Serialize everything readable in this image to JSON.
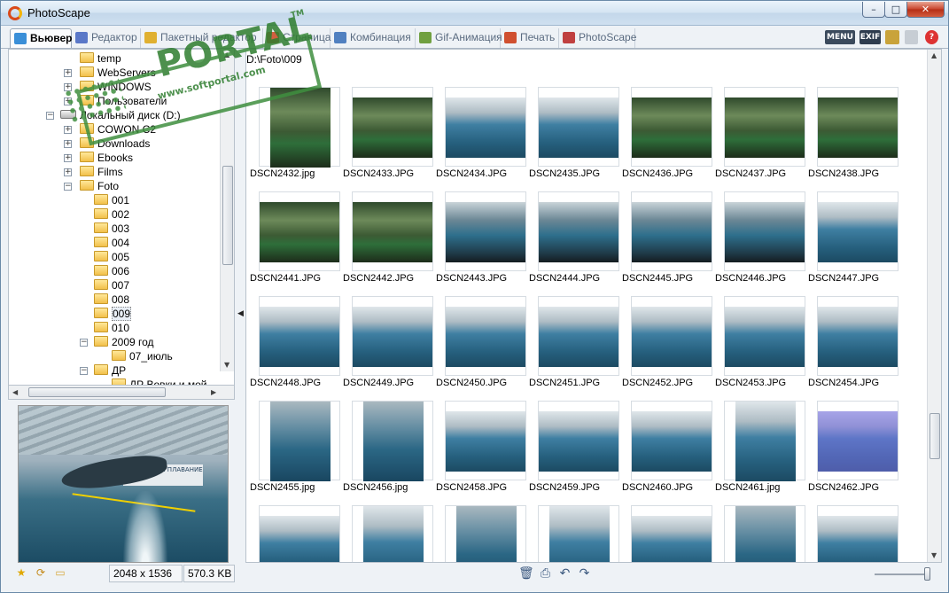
{
  "window": {
    "title": "PhotoScape",
    "min_label": "–",
    "max_label": "□",
    "close_label": "✕"
  },
  "tabs": [
    {
      "label": "Вьювер",
      "icon": "viewer-icon",
      "color": "#3a8fd8",
      "active": true
    },
    {
      "label": "Редактор",
      "icon": "editor-icon",
      "color": "#5a78c8",
      "active": false
    },
    {
      "label": "Пакетный редактор",
      "icon": "batch-editor-icon",
      "color": "#e0b030",
      "active": false
    },
    {
      "label": "Страница",
      "icon": "page-icon",
      "color": "#d06040",
      "active": false
    },
    {
      "label": "Комбинация",
      "icon": "combine-icon",
      "color": "#5080c0",
      "active": false
    },
    {
      "label": "Gif-Анимация",
      "icon": "gif-animation-icon",
      "color": "#70a040",
      "active": false
    },
    {
      "label": "Печать",
      "icon": "print-icon",
      "color": "#d05030",
      "active": false
    },
    {
      "label": "PhotoScape",
      "icon": "photoscape-icon",
      "color": "#c04040",
      "active": false
    }
  ],
  "toolbar_right": {
    "menu_label": "MENU",
    "exif_label": "EXIF",
    "help_label": "?"
  },
  "tree": {
    "items": [
      {
        "label": "temp",
        "type": "folder",
        "expander": ""
      },
      {
        "label": "WebServers",
        "type": "folder",
        "expander": "+"
      },
      {
        "label": "WINDOWS",
        "type": "folder",
        "expander": "+"
      },
      {
        "label": "Пользователи",
        "type": "folder",
        "expander": "+"
      },
      {
        "label": "Локальный диск (D:)",
        "type": "drive",
        "expander": "−"
      },
      {
        "label": "COWON C2",
        "type": "folder",
        "expander": "+"
      },
      {
        "label": "Downloads",
        "type": "folder",
        "expander": "+"
      },
      {
        "label": "Ebooks",
        "type": "folder",
        "expander": "+"
      },
      {
        "label": "Films",
        "type": "folder",
        "expander": "+"
      },
      {
        "label": "Foto",
        "type": "folder",
        "expander": "−"
      },
      {
        "label": "001",
        "type": "folder",
        "expander": ""
      },
      {
        "label": "002",
        "type": "folder",
        "expander": ""
      },
      {
        "label": "003",
        "type": "folder",
        "expander": ""
      },
      {
        "label": "004",
        "type": "folder",
        "expander": ""
      },
      {
        "label": "005",
        "type": "folder",
        "expander": ""
      },
      {
        "label": "006",
        "type": "folder",
        "expander": ""
      },
      {
        "label": "007",
        "type": "folder",
        "expander": ""
      },
      {
        "label": "008",
        "type": "folder",
        "expander": ""
      },
      {
        "label": "009",
        "type": "folder",
        "expander": "",
        "selected": true
      },
      {
        "label": "010",
        "type": "folder",
        "expander": ""
      },
      {
        "label": "2009 год",
        "type": "folder",
        "expander": "−"
      },
      {
        "label": "07_июль",
        "type": "folder",
        "expander": ""
      },
      {
        "label": "ДР",
        "type": "folder",
        "expander": "−"
      },
      {
        "label": "ДР Вовки и мой",
        "type": "folder",
        "expander": ""
      }
    ]
  },
  "status": {
    "dimensions": "2048 x 1536",
    "filesize": "570.3 KB"
  },
  "main": {
    "path": "D:\\Foto\\009",
    "thumbnails": [
      {
        "name": "DSCN2432.jpg",
        "scene": "show",
        "orient": "portrait"
      },
      {
        "name": "DSCN2433.JPG",
        "scene": "show",
        "orient": "landscape"
      },
      {
        "name": "DSCN2434.JPG",
        "scene": "pool",
        "orient": "landscape"
      },
      {
        "name": "DSCN2435.JPG",
        "scene": "pool",
        "orient": "landscape"
      },
      {
        "name": "DSCN2436.JPG",
        "scene": "show",
        "orient": "landscape"
      },
      {
        "name": "DSCN2437.JPG",
        "scene": "show",
        "orient": "landscape"
      },
      {
        "name": "DSCN2438.JPG",
        "scene": "show",
        "orient": "landscape"
      },
      {
        "name": "DSCN2441.JPG",
        "scene": "show",
        "orient": "landscape"
      },
      {
        "name": "DSCN2442.JPG",
        "scene": "show",
        "orient": "landscape"
      },
      {
        "name": "DSCN2443.JPG",
        "scene": "crowd",
        "orient": "landscape"
      },
      {
        "name": "DSCN2444.JPG",
        "scene": "crowd",
        "orient": "landscape"
      },
      {
        "name": "DSCN2445.JPG",
        "scene": "crowd",
        "orient": "landscape"
      },
      {
        "name": "DSCN2446.JPG",
        "scene": "crowd",
        "orient": "landscape"
      },
      {
        "name": "DSCN2447.JPG",
        "scene": "pool",
        "orient": "landscape"
      },
      {
        "name": "DSCN2448.JPG",
        "scene": "pool",
        "orient": "landscape"
      },
      {
        "name": "DSCN2449.JPG",
        "scene": "pool",
        "orient": "landscape"
      },
      {
        "name": "DSCN2450.JPG",
        "scene": "pool",
        "orient": "landscape"
      },
      {
        "name": "DSCN2451.JPG",
        "scene": "pool",
        "orient": "landscape"
      },
      {
        "name": "DSCN2452.JPG",
        "scene": "pool",
        "orient": "landscape"
      },
      {
        "name": "DSCN2453.JPG",
        "scene": "pool",
        "orient": "landscape"
      },
      {
        "name": "DSCN2454.JPG",
        "scene": "pool",
        "orient": "landscape"
      },
      {
        "name": "DSCN2455.jpg",
        "scene": "dolphin",
        "orient": "portrait"
      },
      {
        "name": "DSCN2456.jpg",
        "scene": "dolphin",
        "orient": "portrait"
      },
      {
        "name": "DSCN2458.JPG",
        "scene": "pool",
        "orient": "landscape"
      },
      {
        "name": "DSCN2459.JPG",
        "scene": "pool",
        "orient": "landscape"
      },
      {
        "name": "DSCN2460.JPG",
        "scene": "pool",
        "orient": "landscape"
      },
      {
        "name": "DSCN2461.jpg",
        "scene": "pool",
        "orient": "portrait"
      },
      {
        "name": "DSCN2462.JPG",
        "scene": "pool",
        "orient": "landscape",
        "selected": true
      },
      {
        "name": "",
        "scene": "pool",
        "orient": "landscape"
      },
      {
        "name": "",
        "scene": "pool",
        "orient": "portrait"
      },
      {
        "name": "",
        "scene": "dolphin",
        "orient": "portrait"
      },
      {
        "name": "",
        "scene": "pool",
        "orient": "portrait"
      },
      {
        "name": "",
        "scene": "pool",
        "orient": "landscape"
      },
      {
        "name": "",
        "scene": "dolphin",
        "orient": "portrait"
      },
      {
        "name": "",
        "scene": "pool",
        "orient": "landscape"
      }
    ]
  },
  "preview": {
    "banner_text": "ПОДВОДНОЕ ПЛАВАНИЕ"
  },
  "watermark": {
    "brand": "PORTAL",
    "tm": "TM",
    "url": "www.softportal.com"
  },
  "bottom_toolbar": {
    "icons": [
      "delete-icon",
      "print-icon",
      "rotate-left-icon",
      "rotate-right-icon"
    ]
  },
  "colors": {
    "accent": "#3a8fd8",
    "selection": "#7a6ee6",
    "watermark": "#2e7d2e",
    "close": "#c8432b"
  }
}
